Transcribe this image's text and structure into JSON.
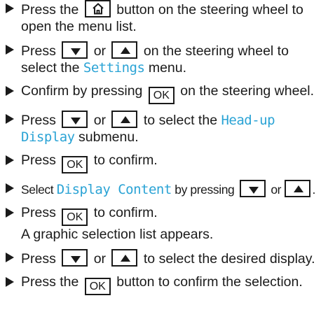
{
  "steps": [
    {
      "a": "Press the",
      "b": "button on the steering wheel to open the menu list."
    },
    {
      "a": "Press",
      "or": "or",
      "b": "on the steering wheel to select the",
      "menu": "Settings",
      "c": "menu."
    },
    {
      "a": "Confirm by pressing",
      "ok": "OK",
      "b": "on the steering wheel."
    },
    {
      "a": "Press",
      "or": "or",
      "b": "to select the",
      "menu": "Head-up Display",
      "c": "submenu."
    },
    {
      "a": "Press",
      "ok": "OK",
      "b": "to confirm."
    },
    {
      "a": "Select",
      "menu": "Display Content",
      "b": "by pressing",
      "or": "or",
      "c": "."
    },
    {
      "a": "Press",
      "ok": "OK",
      "b": "to confirm.",
      "sub": "A graphic selection list appears."
    },
    {
      "a": "Press",
      "or": "or",
      "b": "to select the desired display."
    },
    {
      "a": "Press the",
      "ok": "OK",
      "b": "button to confirm the selection."
    }
  ],
  "icons": {
    "home": "home-icon",
    "down": "down-arrow-icon",
    "up": "up-arrow-icon",
    "bullet": "triangle-bullet-icon"
  },
  "colors": {
    "text": "#1a1a1a",
    "menu_term": "#2aa3d5"
  }
}
